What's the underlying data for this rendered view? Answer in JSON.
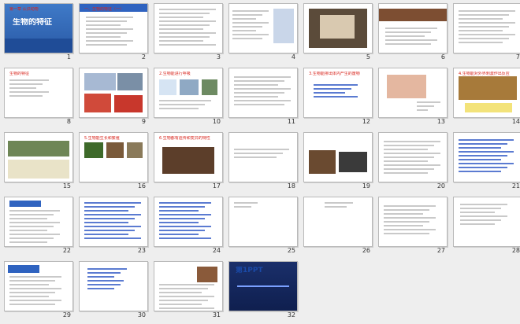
{
  "slides": [
    {
      "n": "1",
      "title": "第一章 认识动物",
      "heading": "生物的特征"
    },
    {
      "n": "2",
      "title": "一、生物的特征（一）",
      "heading": ""
    },
    {
      "n": "3",
      "title": "",
      "heading": ""
    },
    {
      "n": "4",
      "title": "",
      "heading": ""
    },
    {
      "n": "5",
      "title": "",
      "heading": ""
    },
    {
      "n": "6",
      "title": "",
      "heading": ""
    },
    {
      "n": "7",
      "title": "",
      "heading": ""
    },
    {
      "n": "8",
      "title": "生物的特征",
      "heading": ""
    },
    {
      "n": "9",
      "title": "",
      "heading": ""
    },
    {
      "n": "10",
      "title": "2.生物能进行呼吸",
      "heading": ""
    },
    {
      "n": "11",
      "title": "",
      "heading": ""
    },
    {
      "n": "12",
      "title": "3.生物能排出体内产生的废物",
      "heading": ""
    },
    {
      "n": "13",
      "title": "",
      "heading": ""
    },
    {
      "n": "14",
      "title": "4.生物能对外界刺激作出反应",
      "heading": ""
    },
    {
      "n": "15",
      "title": "",
      "heading": ""
    },
    {
      "n": "16",
      "title": "5.生物能生长和繁殖",
      "heading": ""
    },
    {
      "n": "17",
      "title": "6.生物都有遗传和变异的特性",
      "heading": ""
    },
    {
      "n": "18",
      "title": "",
      "heading": ""
    },
    {
      "n": "19",
      "title": "",
      "heading": ""
    },
    {
      "n": "20",
      "title": "",
      "heading": ""
    },
    {
      "n": "21",
      "title": "",
      "heading": ""
    },
    {
      "n": "22",
      "title": "",
      "heading": ""
    },
    {
      "n": "23",
      "title": "",
      "heading": ""
    },
    {
      "n": "24",
      "title": "",
      "heading": ""
    },
    {
      "n": "25",
      "title": "",
      "heading": ""
    },
    {
      "n": "26",
      "title": "",
      "heading": ""
    },
    {
      "n": "27",
      "title": "",
      "heading": ""
    },
    {
      "n": "28",
      "title": "",
      "heading": ""
    },
    {
      "n": "29",
      "title": "",
      "heading": ""
    },
    {
      "n": "30",
      "title": "",
      "heading": ""
    },
    {
      "n": "31",
      "title": "",
      "heading": ""
    },
    {
      "n": "32",
      "title": "",
      "heading": "第1PPT"
    }
  ],
  "colors": {
    "accent": "#d8241c",
    "brand_blue": "#1a4aa8",
    "background": "#eeeeee"
  }
}
